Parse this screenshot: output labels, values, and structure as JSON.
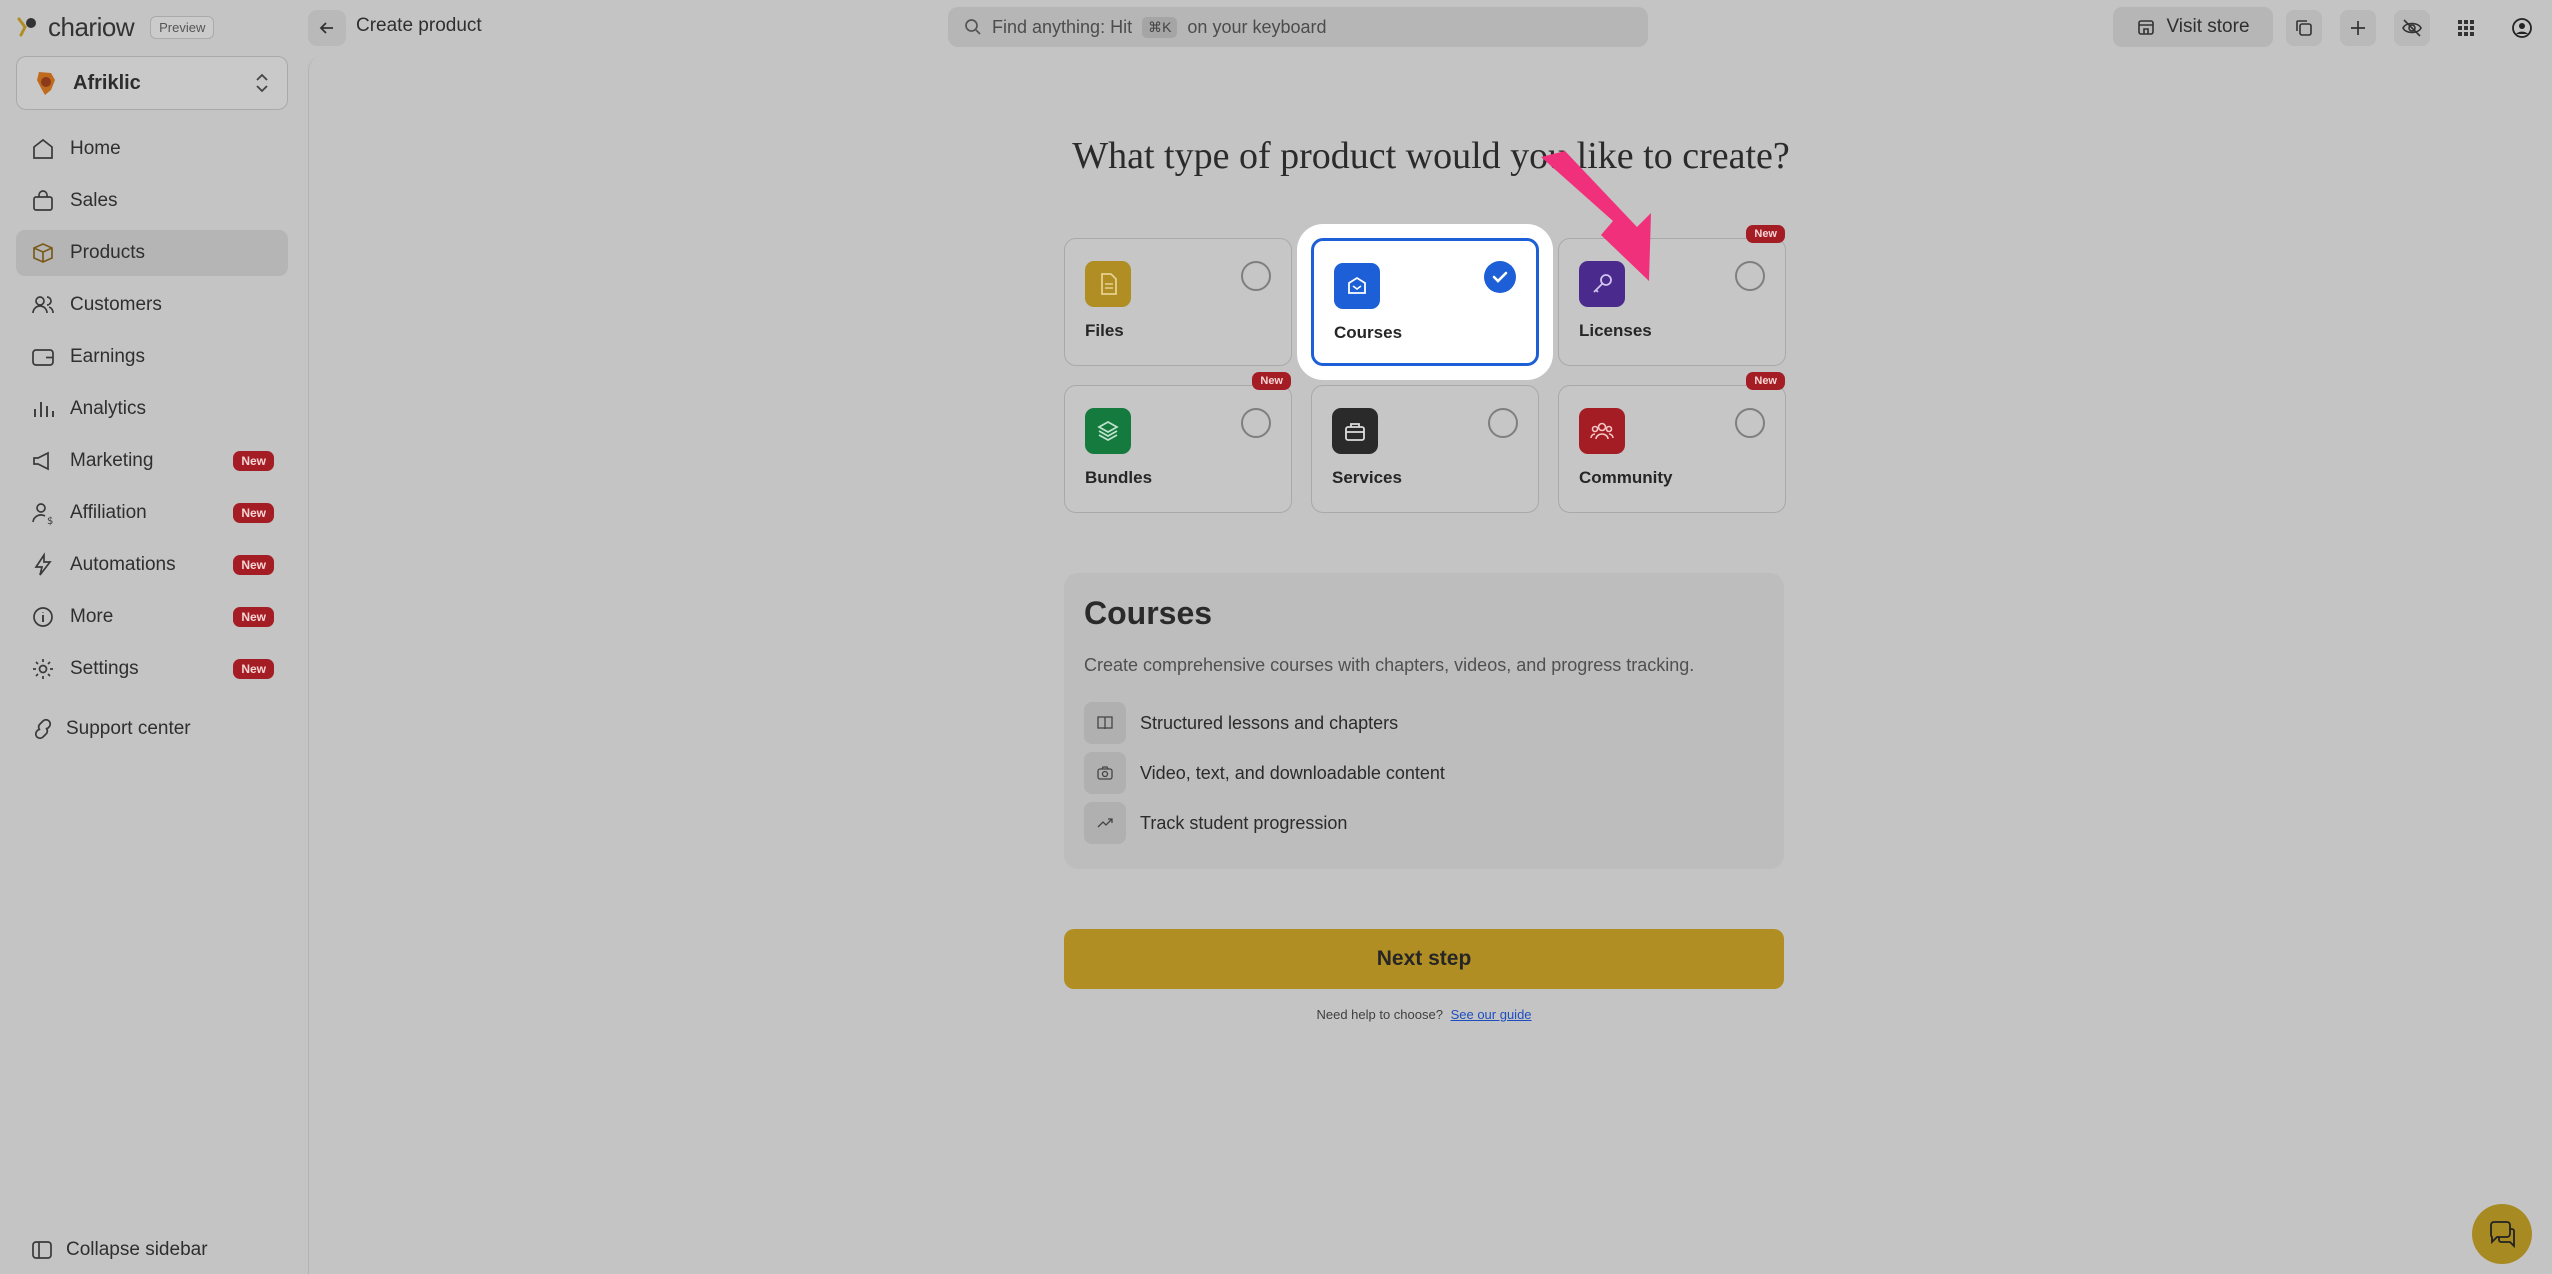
{
  "brand": {
    "name": "chariow",
    "tag": "Preview"
  },
  "store": {
    "name": "Afriklic"
  },
  "sidebar": {
    "items": [
      {
        "label": "Home",
        "icon": "home-icon",
        "badge": ""
      },
      {
        "label": "Sales",
        "icon": "shopping-bag-icon",
        "badge": ""
      },
      {
        "label": "Products",
        "icon": "box-icon",
        "badge": "",
        "active": true
      },
      {
        "label": "Customers",
        "icon": "users-icon",
        "badge": ""
      },
      {
        "label": "Earnings",
        "icon": "wallet-icon",
        "badge": ""
      },
      {
        "label": "Analytics",
        "icon": "chart-icon",
        "badge": ""
      },
      {
        "label": "Marketing",
        "icon": "megaphone-icon",
        "badge": "New"
      },
      {
        "label": "Affiliation",
        "icon": "user-dollar-icon",
        "badge": "New"
      },
      {
        "label": "Automations",
        "icon": "lightning-icon",
        "badge": "New"
      },
      {
        "label": "More",
        "icon": "info-icon",
        "badge": "New"
      },
      {
        "label": "Settings",
        "icon": "gear-icon",
        "badge": "New"
      }
    ],
    "support_label": "Support center",
    "collapse_label": "Collapse sidebar"
  },
  "topbar": {
    "title": "Create product",
    "search_prefix": "Find anything: Hit",
    "search_kbd": "⌘K",
    "search_suffix": "on your keyboard",
    "visit_store": "Visit store"
  },
  "main": {
    "question": "What type of product would you like to create?",
    "product_types": [
      {
        "label": "Files",
        "icon": "file-icon",
        "color": "#b08e24",
        "badge": "",
        "selected": false
      },
      {
        "label": "Courses",
        "icon": "course-icon",
        "color": "#1d5fd6",
        "badge": "",
        "selected": true
      },
      {
        "label": "Licenses",
        "icon": "key-icon",
        "color": "#4a2a8c",
        "badge": "New",
        "selected": false
      },
      {
        "label": "Bundles",
        "icon": "layers-icon",
        "color": "#157a3e",
        "badge": "New",
        "selected": false
      },
      {
        "label": "Services",
        "icon": "briefcase-icon",
        "color": "#2a2a2a",
        "badge": "",
        "selected": false
      },
      {
        "label": "Community",
        "icon": "community-icon",
        "color": "#a51d24",
        "badge": "New",
        "selected": false
      }
    ],
    "info": {
      "title": "Courses",
      "description": "Create comprehensive courses with chapters, videos, and progress tracking.",
      "features": [
        {
          "label": "Structured lessons and chapters",
          "icon": "book-icon"
        },
        {
          "label": "Video, text, and downloadable content",
          "icon": "camera-icon"
        },
        {
          "label": "Track student progression",
          "icon": "trend-icon"
        }
      ]
    },
    "next_button": "Next step",
    "help_text": "Need help to choose?",
    "help_link": "See our guide"
  },
  "colors": {
    "accent_gold": "#b08e24",
    "selected_blue": "#1d5fd6",
    "badge_red": "#a51d24",
    "arrow_pink": "#f0307a"
  }
}
